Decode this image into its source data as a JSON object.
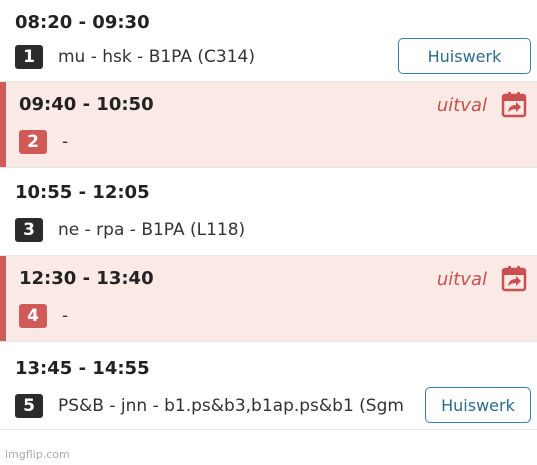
{
  "lessons": [
    {
      "time": "08:20 - 09:30",
      "hour": "1",
      "description": "mu - hsk - B1PA (C314)",
      "homework_label": "Huiswerk"
    },
    {
      "time": "09:40 - 10:50",
      "hour": "2",
      "description": "-",
      "status": "uitval"
    },
    {
      "time": "10:55 - 12:05",
      "hour": "3",
      "description": "ne - rpa - B1PA (L118)"
    },
    {
      "time": "12:30 - 13:40",
      "hour": "4",
      "description": "-",
      "status": "uitval"
    },
    {
      "time": "13:45 - 14:55",
      "hour": "5",
      "description": "PS&B - jnn - b1.ps&b3,b1ap.ps&b1 (Sgm",
      "homework_label": "Huiswerk"
    }
  ],
  "watermark": "imgflip.com",
  "colors": {
    "cancelled_bg": "#fbe9e6",
    "cancelled_accent": "#d05a58",
    "button_border": "#3a7fa3",
    "hour_badge": "#2b2b2b"
  },
  "icons": {
    "cancelled_calendar": "calendar-arrow-icon"
  }
}
